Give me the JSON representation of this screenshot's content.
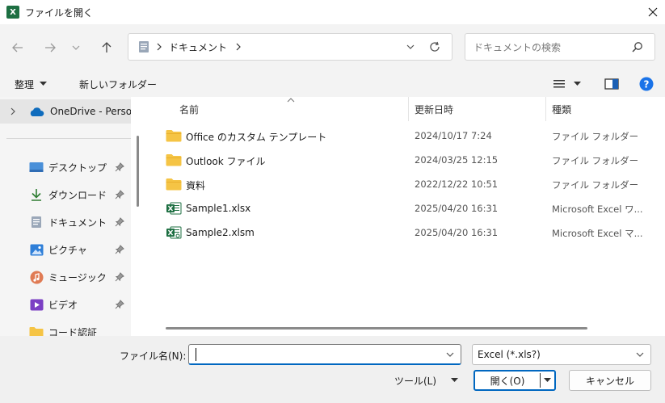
{
  "window": {
    "title": "ファイルを開く",
    "app_icon_letter": "X"
  },
  "nav": {
    "breadcrumb": [
      {
        "label": "ドキュメント"
      }
    ],
    "search_placeholder": "ドキュメントの検索"
  },
  "toolbar": {
    "organize_label": "整理",
    "new_folder_label": "新しいフォルダー"
  },
  "sidebar": {
    "top_label": "OneDrive - Perso",
    "items": [
      {
        "label": "デスクトップ",
        "icon": "desktop-icon"
      },
      {
        "label": "ダウンロード",
        "icon": "download-icon"
      },
      {
        "label": "ドキュメント",
        "icon": "document-icon"
      },
      {
        "label": "ピクチャ",
        "icon": "pictures-icon"
      },
      {
        "label": "ミュージック",
        "icon": "music-icon"
      },
      {
        "label": "ビデオ",
        "icon": "videos-icon"
      },
      {
        "label": "コード認証",
        "icon": "folder-icon"
      }
    ]
  },
  "filelist": {
    "columns": {
      "name": "名前",
      "date": "更新日時",
      "type": "種類"
    },
    "rows": [
      {
        "name": "Office のカスタム テンプレート",
        "date": "2024/10/17 7:24",
        "type": "ファイル フォルダー",
        "kind": "folder"
      },
      {
        "name": "Outlook ファイル",
        "date": "2024/03/25 12:15",
        "type": "ファイル フォルダー",
        "kind": "folder"
      },
      {
        "name": "資料",
        "date": "2022/12/22 10:51",
        "type": "ファイル フォルダー",
        "kind": "folder"
      },
      {
        "name": "Sample1.xlsx",
        "date": "2025/04/20 16:31",
        "type": "Microsoft Excel ワ...",
        "kind": "excel"
      },
      {
        "name": "Sample2.xlsm",
        "date": "2025/04/20 16:31",
        "type": "Microsoft Excel マ...",
        "kind": "excel-macro"
      }
    ]
  },
  "bottom": {
    "filename_label": "ファイル名(N):",
    "filename_value": "",
    "filter_value": "Excel (*.xls?)",
    "tools_label": "ツール(L)",
    "open_label": "開く(O)",
    "cancel_label": "キャンセル"
  },
  "colors": {
    "accent": "#0067c0",
    "folder": "#f5c445",
    "excel": "#1d6f42",
    "help": "#1a73e8"
  }
}
